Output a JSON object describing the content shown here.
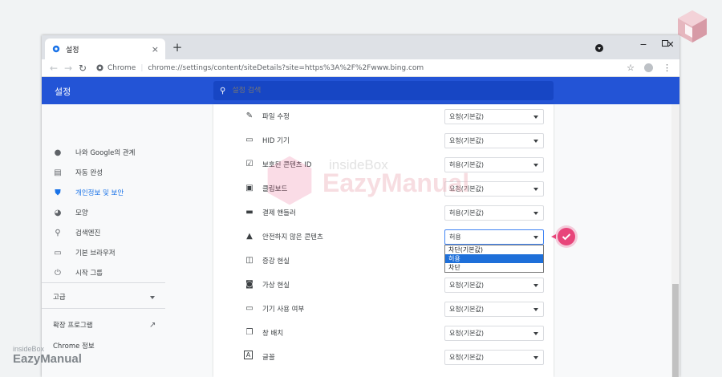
{
  "browser": {
    "tab_title": "설정",
    "tab_close": "×",
    "new_tab": "+",
    "win_min": "−",
    "win_max": "☐",
    "win_close": "✕",
    "chip_label": "Chrome",
    "url": "chrome://settings/content/siteDetails?site=https%3A%2F%2Fwww.bing.com",
    "star": "☆",
    "menu": "⋮"
  },
  "header": {
    "title": "설정",
    "search_placeholder": "설정 검색"
  },
  "sidebar": {
    "items": [
      {
        "label": "나와 Google의 관계",
        "icon": "person-icon"
      },
      {
        "label": "자동 완성",
        "icon": "clipboard-icon"
      },
      {
        "label": "개인정보 및 보안",
        "icon": "shield-icon",
        "active": true
      },
      {
        "label": "모양",
        "icon": "palette-icon"
      },
      {
        "label": "검색엔진",
        "icon": "search-icon"
      },
      {
        "label": "기본 브라우저",
        "icon": "browser-icon"
      },
      {
        "label": "시작 그룹",
        "icon": "power-icon"
      }
    ],
    "advanced": "고급",
    "extensions": "확장 프로그램",
    "about": "Chrome 정보"
  },
  "permissions": [
    {
      "label": "파일 수정",
      "value": "요청(기본값)",
      "icon": "file-edit-icon"
    },
    {
      "label": "HID 기기",
      "value": "요청(기본값)",
      "icon": "gamepad-icon"
    },
    {
      "label": "보호된 콘텐츠 ID",
      "value": "허용(기본값)",
      "icon": "checkbox-icon"
    },
    {
      "label": "클립보드",
      "value": "요청(기본값)",
      "icon": "clipboard-icon"
    },
    {
      "label": "결제 핸들러",
      "value": "허용(기본값)",
      "icon": "card-icon"
    },
    {
      "label": "안전하지 않은 콘텐츠",
      "value": "허용",
      "icon": "warning-icon"
    },
    {
      "label": "증강 현실",
      "value": "",
      "icon": "ar-icon"
    },
    {
      "label": "가상 현실",
      "value": "요청(기본값)",
      "icon": "vr-icon"
    },
    {
      "label": "기기 사용 여부",
      "value": "요청(기본값)",
      "icon": "devices-icon"
    },
    {
      "label": "창 배치",
      "value": "요청(기본값)",
      "icon": "window-placement-icon"
    },
    {
      "label": "글꼴",
      "value": "요청(기본값)",
      "icon": "font-icon"
    }
  ],
  "dropdown_options": [
    "차단(기본값)",
    "허용",
    "차단"
  ],
  "dropdown_selected_index": 1,
  "watermark": {
    "small": "insideBox",
    "big": "EazyManual"
  },
  "colors": {
    "accent": "#2354d6",
    "badge": "#e8457a"
  }
}
